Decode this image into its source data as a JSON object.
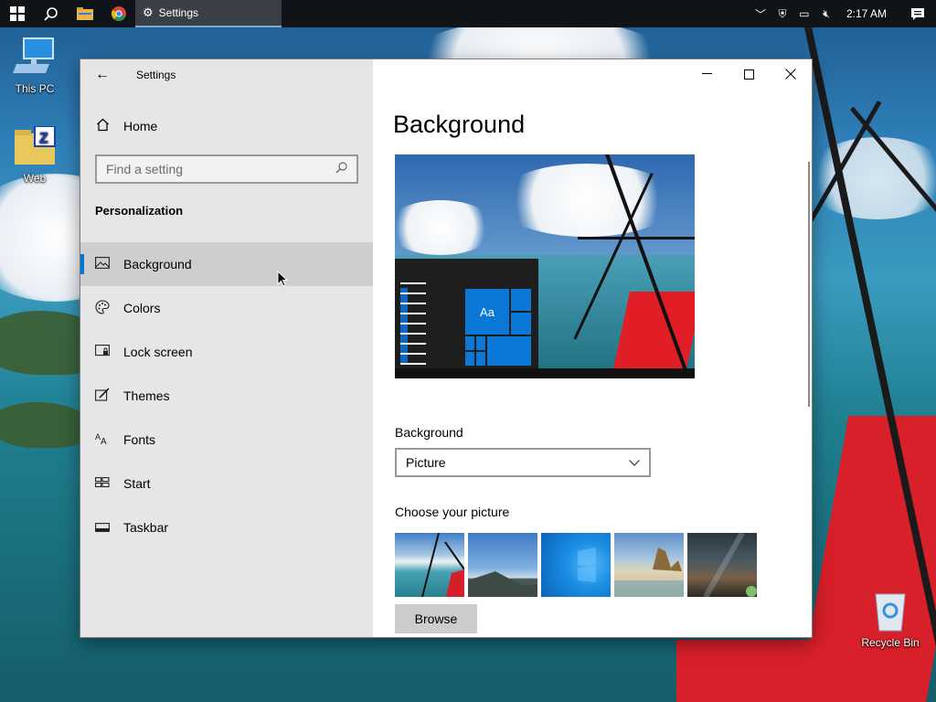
{
  "taskbar": {
    "active_app_label": "Settings",
    "clock": "2:17 AM",
    "icons": [
      "windows-start-icon",
      "search-icon",
      "file-explorer-icon",
      "chrome-icon"
    ],
    "tray_icons": [
      "chevron-up-icon",
      "security-icon",
      "network-icon",
      "volume-muted-icon",
      "action-center-icon"
    ]
  },
  "desktop": {
    "icons": [
      {
        "label": "This PC",
        "icon": "computer-icon"
      },
      {
        "label": "Web",
        "icon": "folder-icon"
      },
      {
        "label": "Recycle Bin",
        "icon": "recycle-bin-icon"
      }
    ]
  },
  "window": {
    "app_title": "Settings",
    "caption": {
      "minimize": "—",
      "maximize": "☐",
      "close": "✕"
    }
  },
  "sidebar": {
    "home_label": "Home",
    "search": {
      "placeholder": "Find a setting"
    },
    "section_title": "Personalization",
    "items": [
      {
        "label": "Background",
        "icon": "picture-icon",
        "active": true
      },
      {
        "label": "Colors",
        "icon": "palette-icon",
        "active": false
      },
      {
        "label": "Lock screen",
        "icon": "lock-screen-icon",
        "active": false
      },
      {
        "label": "Themes",
        "icon": "themes-icon",
        "active": false
      },
      {
        "label": "Fonts",
        "icon": "fonts-icon",
        "active": false
      },
      {
        "label": "Start",
        "icon": "start-icon",
        "active": false
      },
      {
        "label": "Taskbar",
        "icon": "taskbar-icon",
        "active": false
      }
    ]
  },
  "main": {
    "page_title": "Background",
    "preview": {
      "tile_text": "Aa"
    },
    "background_label": "Background",
    "background_value": "Picture",
    "choose_picture_label": "Choose your picture",
    "thumbnails": [
      "airplane-wing-photo",
      "coastline-photo",
      "windows-light-photo",
      "beach-rocks-photo",
      "night-sky-photo"
    ],
    "browse_label": "Browse"
  },
  "colors": {
    "accent": "#0078d7",
    "taskbar": "#101418",
    "sidebar_bg": "#e6e6e6",
    "active_item_bg": "#cecece"
  }
}
